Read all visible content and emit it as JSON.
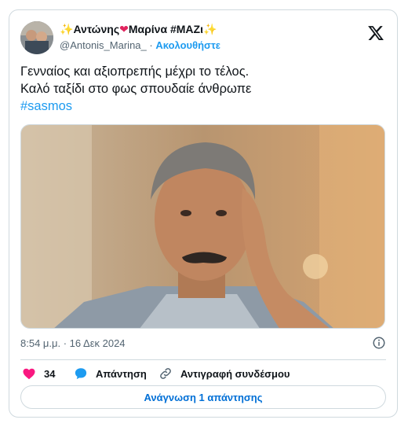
{
  "author": {
    "name_prefix": "✨",
    "name_part1": "Αντώνης",
    "heart": "❤",
    "name_part2": "Μαρίνα #ΜΑΖι",
    "name_suffix": "✨",
    "handle": "@Antonis_Marina_",
    "separator": "·",
    "follow_label": "Ακολουθήστε",
    "avatar_icon": "avatar-photo"
  },
  "platform_logo": "x-logo",
  "tweet": {
    "lines": [
      "Γενναίος και αξιοπρεπής μέχρι το τέλος.",
      "Καλό ταξίδι στο φως σπουδαίε άνθρωπε"
    ],
    "hashtag": "#sasmos"
  },
  "media": {
    "description_icon": "portrait-photo"
  },
  "meta": {
    "timestamp": "8:54 μ.μ. · 16 Δεκ 2024",
    "info_icon": "info-icon"
  },
  "actions": {
    "like_count": "34",
    "reply_label": "Απάντηση",
    "copy_label": "Αντιγραφή συνδέσμου"
  },
  "read_replies_label": "Ανάγνωση 1 απάντησης",
  "colors": {
    "accent": "#1d9bf0",
    "like": "#f91880",
    "border": "#cfd9de",
    "secondary": "#536471"
  }
}
